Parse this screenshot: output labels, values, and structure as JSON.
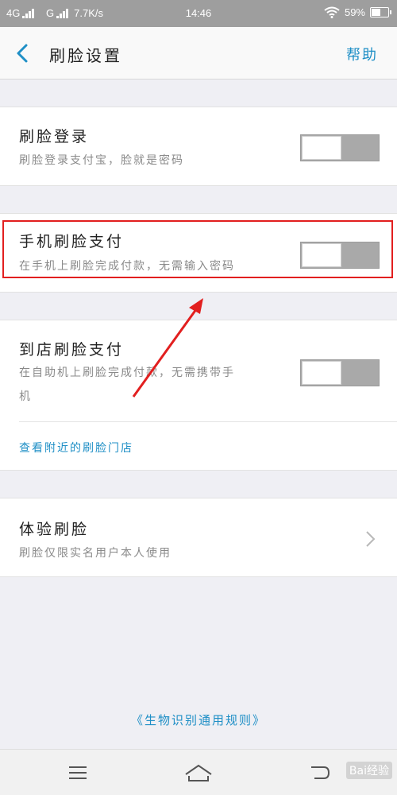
{
  "status_bar": {
    "network1": "4G",
    "network2": "G",
    "speed": "7.7K/s",
    "time": "14:46",
    "battery_percent": "59%",
    "battery_level": 0.59
  },
  "nav": {
    "title": "刷脸设置",
    "help_label": "帮助"
  },
  "settings": {
    "face_login": {
      "title": "刷脸登录",
      "subtitle": "刷脸登录支付宝，脸就是密码",
      "enabled": false
    },
    "phone_face_pay": {
      "title": "手机刷脸支付",
      "subtitle": "在手机上刷脸完成付款，无需输入密码",
      "enabled": false
    },
    "store_face_pay": {
      "title": "到店刷脸支付",
      "subtitle_line1": "在自助机上刷脸完成付款，无需携带手",
      "subtitle_line2": "机",
      "enabled": false,
      "nearby_link": "查看附近的刷脸门店"
    },
    "try_face": {
      "title": "体验刷脸",
      "subtitle": "刷脸仅限实名用户本人使用"
    }
  },
  "footer": {
    "rules_link": "《生物识别通用规则》"
  },
  "watermark": "Bai经验",
  "colors": {
    "accent": "#1f8fc6",
    "highlight": "#e21f1f",
    "toggle_off": "#a9a9a9"
  }
}
